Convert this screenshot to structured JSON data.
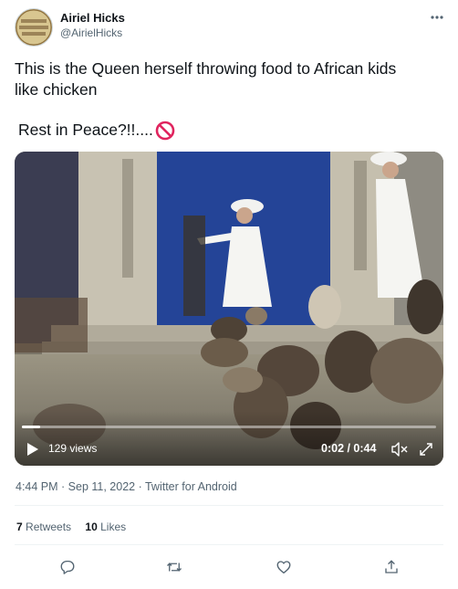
{
  "author": {
    "name": "Airiel Hicks",
    "handle": "@AirielHicks",
    "avatar_icon": "avatar-image"
  },
  "tweet": {
    "text_line1": "This is the Queen herself throwing food to African kids",
    "text_line2": "like chicken",
    "text_line3": "Rest in Peace?!!....",
    "emoji": "no-entry-sign-icon"
  },
  "video": {
    "views": "129 views",
    "time": "0:02 / 0:44",
    "progress_fraction": 0.045
  },
  "meta": {
    "timestamp": "4:44 PM · Sep 11, 2022 · Twitter for Android"
  },
  "stats": {
    "retweets_count": "7",
    "retweets_label": "Retweets",
    "likes_count": "10",
    "likes_label": "Likes"
  },
  "colors": {
    "text": "#0f1419",
    "secondary": "#536471",
    "divider": "#eff3f4",
    "accent_red": "#e0245e"
  }
}
